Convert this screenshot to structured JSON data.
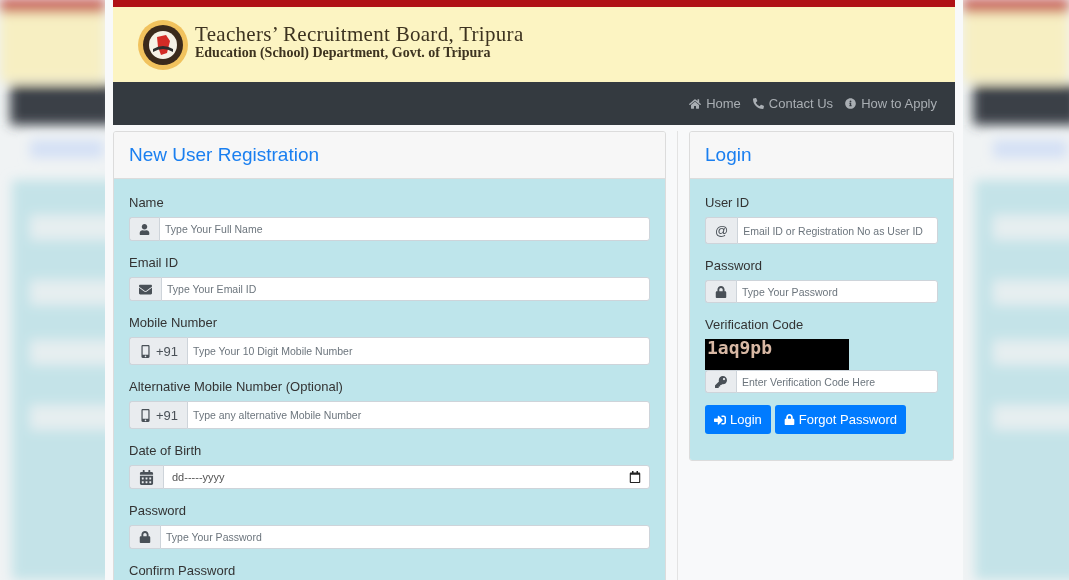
{
  "header": {
    "title": "Teachers’ Recruitment Board, Tripura",
    "subtitle": "Education (School) Department, Govt. of Tripura"
  },
  "nav": [
    {
      "kind": "home",
      "label": "Home"
    },
    {
      "kind": "phone",
      "label": "Contact Us"
    },
    {
      "kind": "info",
      "label": "How to Apply"
    }
  ],
  "registration": {
    "title": "New User Registration",
    "fields": [
      {
        "kind": "text",
        "label": "Name",
        "addon": {
          "kind": "user"
        },
        "placeholder": "Type Your Full Name"
      },
      {
        "kind": "text",
        "label": "Email ID",
        "addon": {
          "kind": "envelope"
        },
        "placeholder": "Type Your Email ID"
      },
      {
        "kind": "text",
        "label": "Mobile Number",
        "addon": {
          "kind": "mobile",
          "text": "+91"
        },
        "placeholder": "Type Your 10 Digit Mobile Number"
      },
      {
        "kind": "text",
        "label": "Alternative Mobile Number (Optional)",
        "addon": {
          "kind": "mobile",
          "text": "+91"
        },
        "placeholder": "Type any alternative Mobile Number"
      },
      {
        "kind": "date",
        "label": "Date of Birth",
        "addon": {
          "kind": "calendar"
        },
        "value": "dd-----yyyy"
      },
      {
        "kind": "text",
        "label": "Password",
        "addon": {
          "kind": "lock"
        },
        "placeholder": "Type Your Password"
      },
      {
        "kind": "label",
        "label": "Confirm Password"
      }
    ]
  },
  "login": {
    "title": "Login",
    "fields": [
      {
        "kind": "text",
        "label": "User ID",
        "addon": {
          "kind": "text",
          "text": "@"
        },
        "placeholder": "Email ID or Registration No as User ID"
      },
      {
        "kind": "text",
        "label": "Password",
        "addon": {
          "kind": "lock"
        },
        "placeholder": "Type Your Password"
      }
    ],
    "captcha": {
      "label": "Verification Code",
      "code": "1aq9pb",
      "addon": {
        "kind": "key"
      },
      "placeholder": "Enter Verification Code Here"
    },
    "buttons": [
      {
        "kind": "login",
        "label": "Login"
      },
      {
        "kind": "lock",
        "label": "Forgot Password"
      }
    ]
  }
}
